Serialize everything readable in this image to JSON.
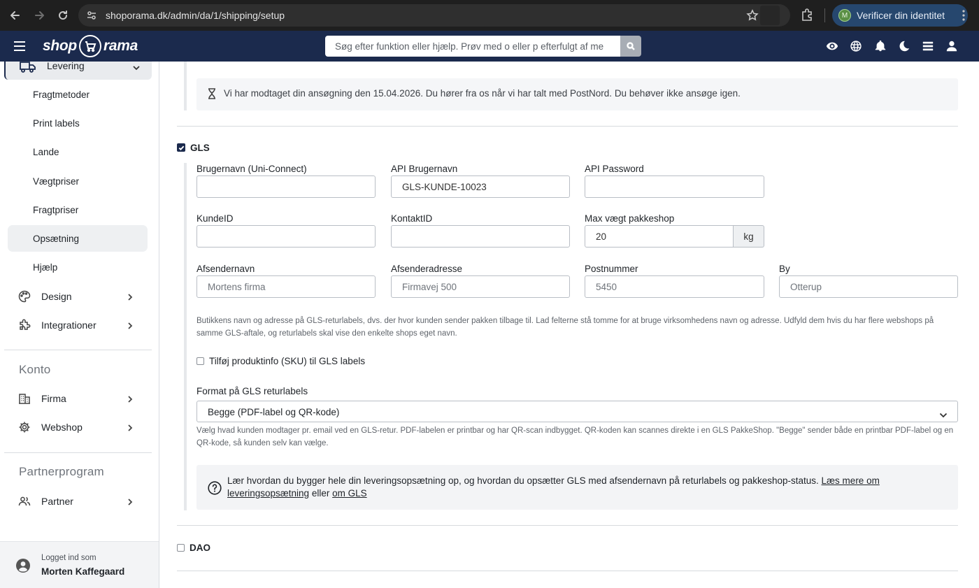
{
  "browser": {
    "url": "shoporama.dk/admin/da/1/shipping/setup",
    "profile_initial": "M",
    "profile_label": "Verificer din identitet"
  },
  "header": {
    "logo_left": "shop",
    "logo_right": "rama",
    "search_placeholder": "Søg efter funktion eller hjælp. Prøv med o eller p efterfulgt af me"
  },
  "sidebar": {
    "active_group": "Levering",
    "sub_items": [
      {
        "label": "Fragtmetoder",
        "active": false
      },
      {
        "label": "Print labels",
        "active": false
      },
      {
        "label": "Lande",
        "active": false
      },
      {
        "label": "Vægtpriser",
        "active": false
      },
      {
        "label": "Fragtpriser",
        "active": false
      },
      {
        "label": "Opsætning",
        "active": true
      },
      {
        "label": "Hjælp",
        "active": false
      }
    ],
    "groups": [
      {
        "label": "Design",
        "icon": "palette-icon"
      },
      {
        "label": "Integrationer",
        "icon": "puzzle-icon"
      }
    ],
    "section_account": "Konto",
    "account_items": [
      {
        "label": "Firma",
        "icon": "building-icon"
      },
      {
        "label": "Webshop",
        "icon": "gear-icon"
      }
    ],
    "section_partner": "Partnerprogram",
    "partner_items": [
      {
        "label": "Partner",
        "icon": "users-icon"
      }
    ],
    "footer": {
      "logged_in_as": "Logget ind som",
      "user_name": "Morten Kaffegaard"
    }
  },
  "main": {
    "postnord_notice": "Vi har modtaget din ansøgning den 15.04.2026. Du hører fra os når vi har talt med PostNord. Du behøver ikke ansøge igen.",
    "gls": {
      "label": "GLS",
      "checked": true,
      "fields": {
        "username_label": "Brugernavn (Uni-Connect)",
        "username_value": "",
        "api_user_label": "API Brugernavn",
        "api_user_value": "GLS-KUNDE-10023",
        "api_password_label": "API Password",
        "api_password_value": "",
        "customer_id_label": "KundeID",
        "customer_id_value": "",
        "contact_id_label": "KontaktID",
        "contact_id_value": "",
        "max_weight_label": "Max vægt pakkeshop",
        "max_weight_value": "20",
        "max_weight_unit": "kg",
        "sender_name_label": "Afsendernavn",
        "sender_name_placeholder": "Mortens firma",
        "sender_address_label": "Afsenderadresse",
        "sender_address_placeholder": "Firmavej 500",
        "postcode_label": "Postnummer",
        "postcode_placeholder": "5450",
        "city_label": "By",
        "city_placeholder": "Otterup"
      },
      "sender_help": "Butikkens navn og adresse på GLS-returlabels, dvs. der hvor kunden sender pakken tilbage til. Lad felterne stå tomme for at bruge virksomhedens navn og adresse. Udfyld dem hvis du har flere webshops på samme GLS-aftale, og returlabels skal vise den enkelte shops eget navn.",
      "sku_label": "Tilføj produktinfo (SKU) til GLS labels",
      "sku_checked": false,
      "return_format_label": "Format på GLS returlabels",
      "return_format_value": "Begge (PDF-label og QR-kode)",
      "return_format_help": "Vælg hvad kunden modtager pr. email ved en GLS-retur. PDF-labelen er printbar og har QR-scan indbygget. QR-koden kan scannes direkte i en GLS PakkeShop. \"Begge\" sender både en printbar PDF-label og en QR-kode, så kunden selv kan vælge.",
      "help_box": {
        "text": "Lær hvordan du bygger hele din leveringsopsætning op, og hvordan du opsætter GLS med afsendernavn på returlabels og pakkeshop-status.",
        "link1": "Læs mere om leveringsopsætning",
        "between": "eller",
        "link2": "om GLS"
      }
    },
    "dao": {
      "label": "DAO",
      "checked": false
    }
  }
}
